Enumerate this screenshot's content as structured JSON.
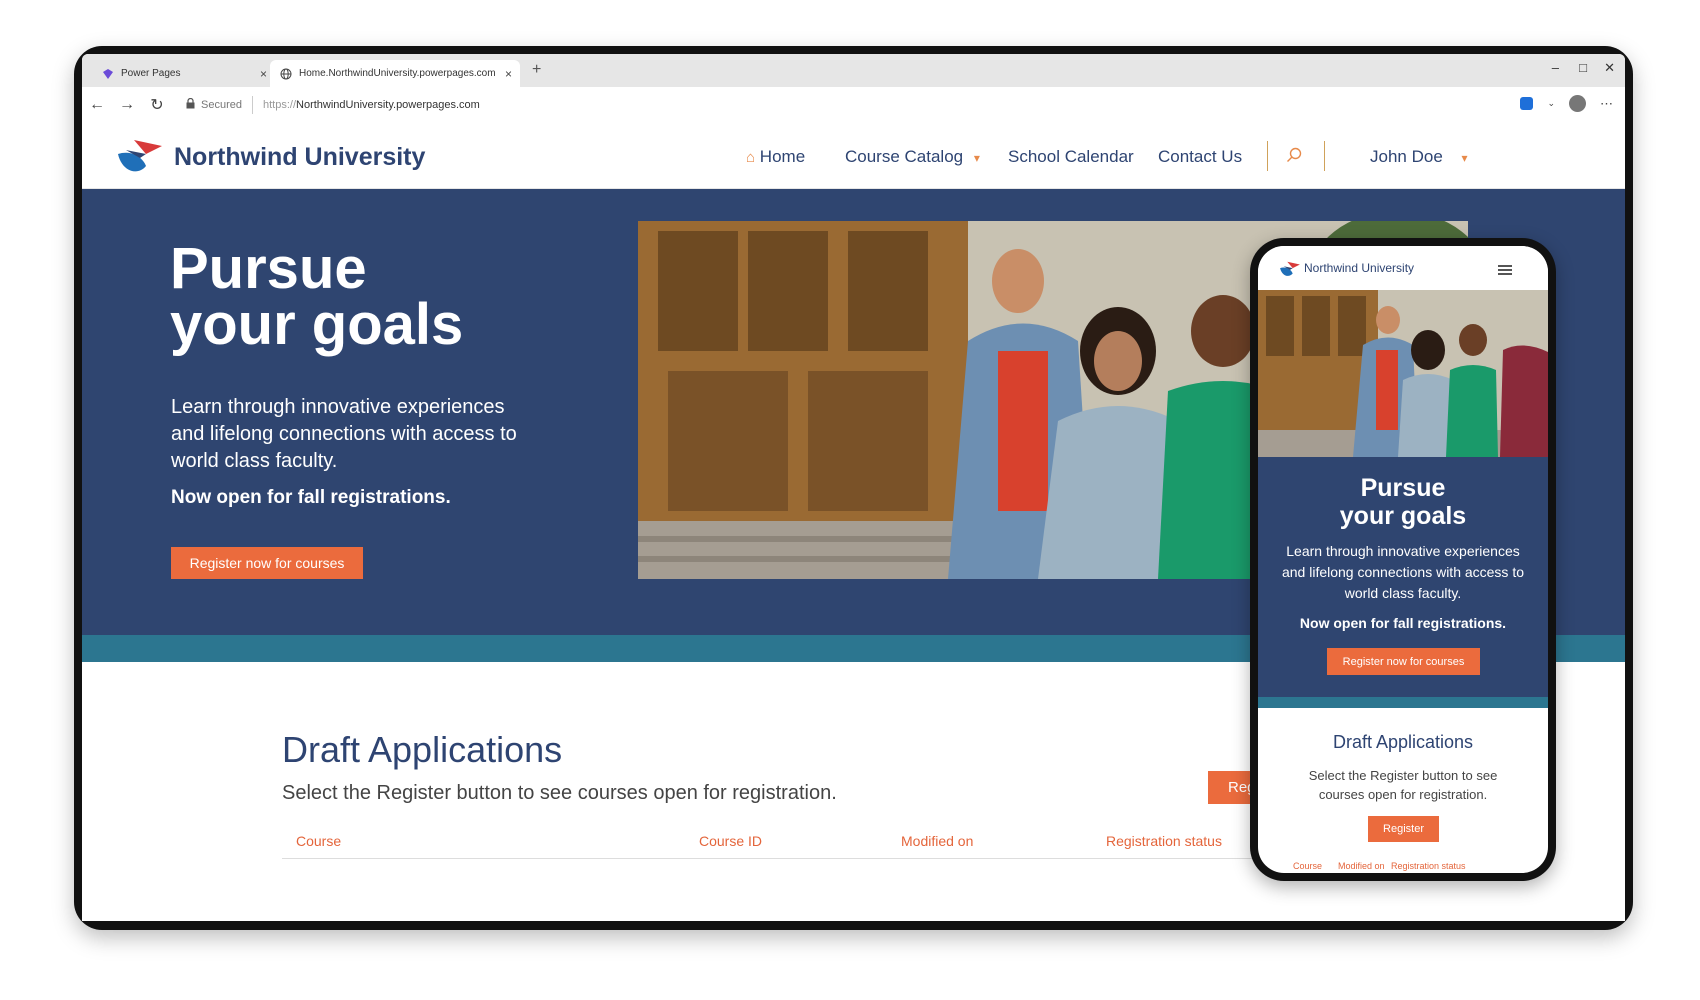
{
  "browser": {
    "tab1_label": "Power Pages",
    "tab2_label": "Home.NorthwindUniversity.powerpages.com",
    "new_tab": "+",
    "close_tab": "×",
    "secured_label": "Secured",
    "url_scheme": "https://",
    "url_rest": "NorthwindUniversity.powerpages.com",
    "window_controls": [
      "–",
      "□",
      "✕"
    ]
  },
  "site": {
    "brand": "Northwind University",
    "nav": {
      "home": "Home",
      "catalog": "Course Catalog",
      "calendar": "School Calendar",
      "contact": "Contact Us",
      "user": "John Doe"
    }
  },
  "hero": {
    "title_line1": "Pursue",
    "title_line2": "your goals",
    "lede": "Learn through innovative experiences and lifelong connections with access to world class faculty.",
    "open_notice": "Now open for fall registrations.",
    "cta": "Register now for courses"
  },
  "draft": {
    "title": "Draft Applications",
    "subtitle": "Select the Register button to see courses open for registration.",
    "register_button": "Regi",
    "columns": [
      "Course",
      "Course ID",
      "Modified on",
      "Registration status"
    ]
  },
  "mobile": {
    "brand": "Northwind University",
    "title_line1": "Pursue",
    "title_line2": "your goals",
    "lede": "Learn through innovative experiences and lifelong connections with access to world class faculty.",
    "open_notice": "Now open for fall registrations.",
    "cta": "Register now for courses",
    "draft_title": "Draft Applications",
    "draft_subtitle": "Select the Register button to see courses open for registration.",
    "register_button": "Register",
    "columns": [
      "Course",
      "Modified on",
      "Registration status"
    ]
  },
  "colors": {
    "navy": "#2f4570",
    "teal_strip": "#2c7690",
    "orange": "#eb6b3d",
    "brand_text": "#2e4472"
  }
}
